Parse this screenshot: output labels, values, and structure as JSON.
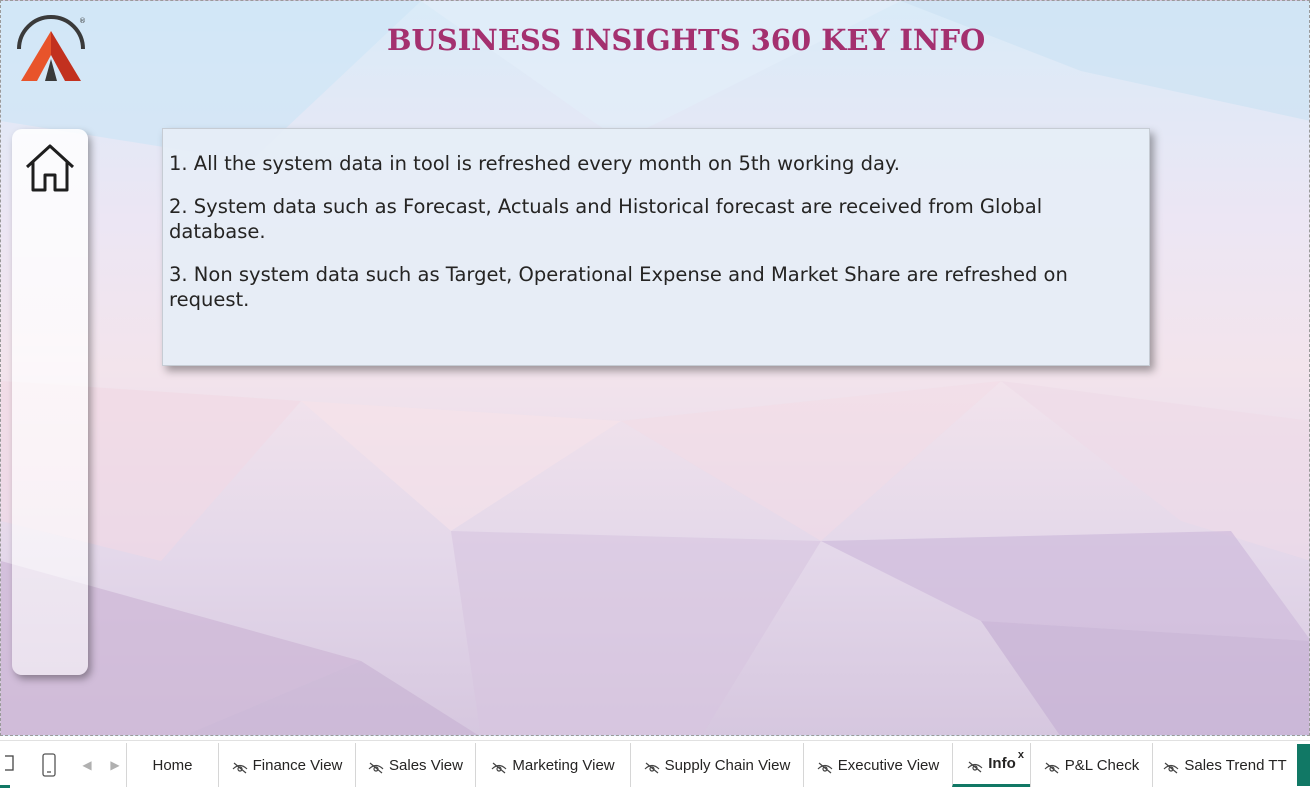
{
  "header": {
    "title": "BUSINESS INSIGHTS 360 KEY INFO"
  },
  "sidebar": {
    "home_icon": "home-icon"
  },
  "info": {
    "points": [
      "1. All the system data in tool is refreshed every month on 5th working day.",
      "2.  System data such as Forecast, Actuals and Historical forecast are received from Global database.",
      "3.  Non system data such as Target, Operational Expense and Market Share are refreshed on request."
    ]
  },
  "tabs": {
    "items": [
      {
        "label": "Home",
        "hidden": false
      },
      {
        "label": "Finance View",
        "hidden": true
      },
      {
        "label": "Sales View",
        "hidden": true
      },
      {
        "label": "Marketing View",
        "hidden": true
      },
      {
        "label": "Supply Chain View",
        "hidden": true
      },
      {
        "label": "Executive View",
        "hidden": true
      },
      {
        "label": "Info",
        "hidden": true,
        "active": true
      },
      {
        "label": "P&L Check",
        "hidden": true
      },
      {
        "label": "Sales Trend TT",
        "hidden": true
      }
    ],
    "close_label": "x"
  },
  "colors": {
    "title": "#a4306f",
    "accent": "#117865",
    "logo_orange": "#e8542b"
  }
}
